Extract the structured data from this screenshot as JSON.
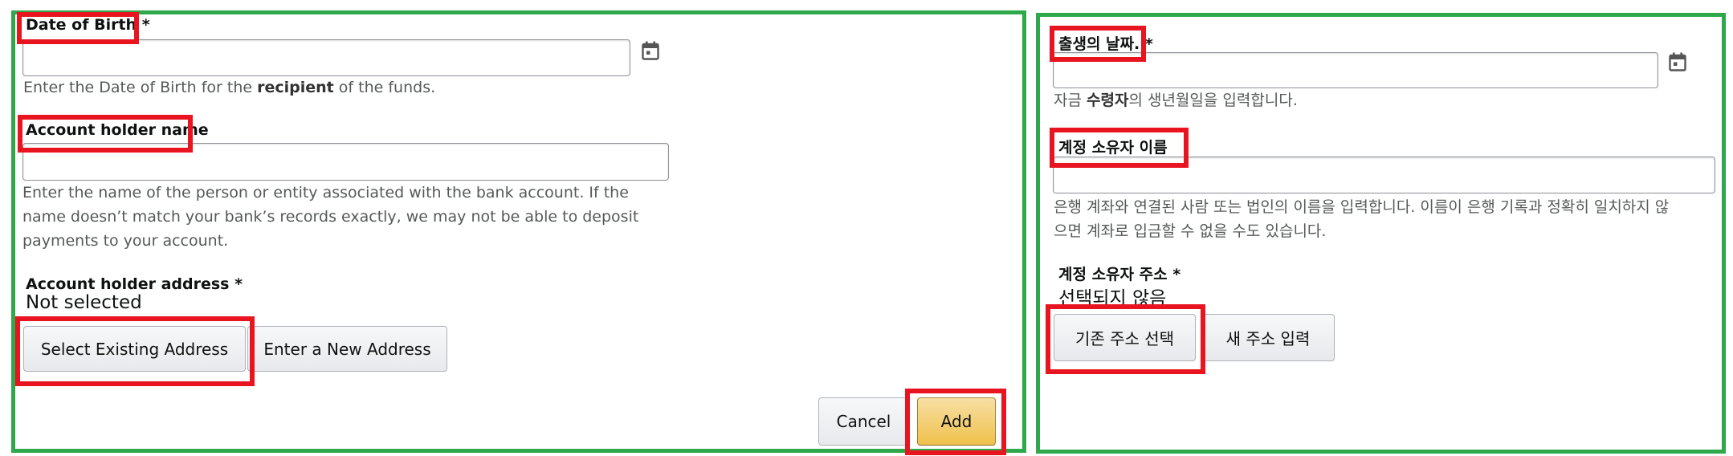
{
  "english": {
    "dob_label": "Date of Birth *",
    "dob_value": "",
    "dob_help_before": "Enter the Date of Birth for the ",
    "dob_help_bold": "recipient",
    "dob_help_after": " of the funds.",
    "holder_name_label": "Account holder name",
    "holder_name_value": "",
    "holder_name_help": "Enter the name of the person or entity associated with the bank account. If the name doesn’t match your bank’s records exactly, we may not be able to deposit payments to your account.",
    "address_label": "Account holder address *",
    "address_value": "Not selected",
    "select_existing_button": "Select Existing Address",
    "enter_new_button": "Enter a New Address",
    "cancel_button": "Cancel",
    "add_button": "Add"
  },
  "korean": {
    "dob_label": "출생의 날짜. *",
    "dob_value": "",
    "dob_help_before": "자금 ",
    "dob_help_bold": "수령자",
    "dob_help_after": "의 생년월일을 입력합니다.",
    "holder_name_label": "계정 소유자 이름",
    "holder_name_value": "",
    "holder_name_help": "은행 계좌와 연결된 사람 또는 법인의 이름을 입력합니다. 이름이 은행 기록과 정확히 일치하지 않으면 계좌로 입금할 수 없을 수도 있습니다.",
    "address_label": "계정 소유자 주소 *",
    "address_value": "선택되지 않음",
    "select_existing_button": "기존 주소 선택",
    "enter_new_button": "새 주소 입력"
  },
  "colors": {
    "panel_border": "#2ea84a",
    "highlight_border": "#e8141f",
    "primary_button": "#f0c14b",
    "help_text": "#565959"
  },
  "icons": {
    "date_picker": "calendar-icon"
  }
}
